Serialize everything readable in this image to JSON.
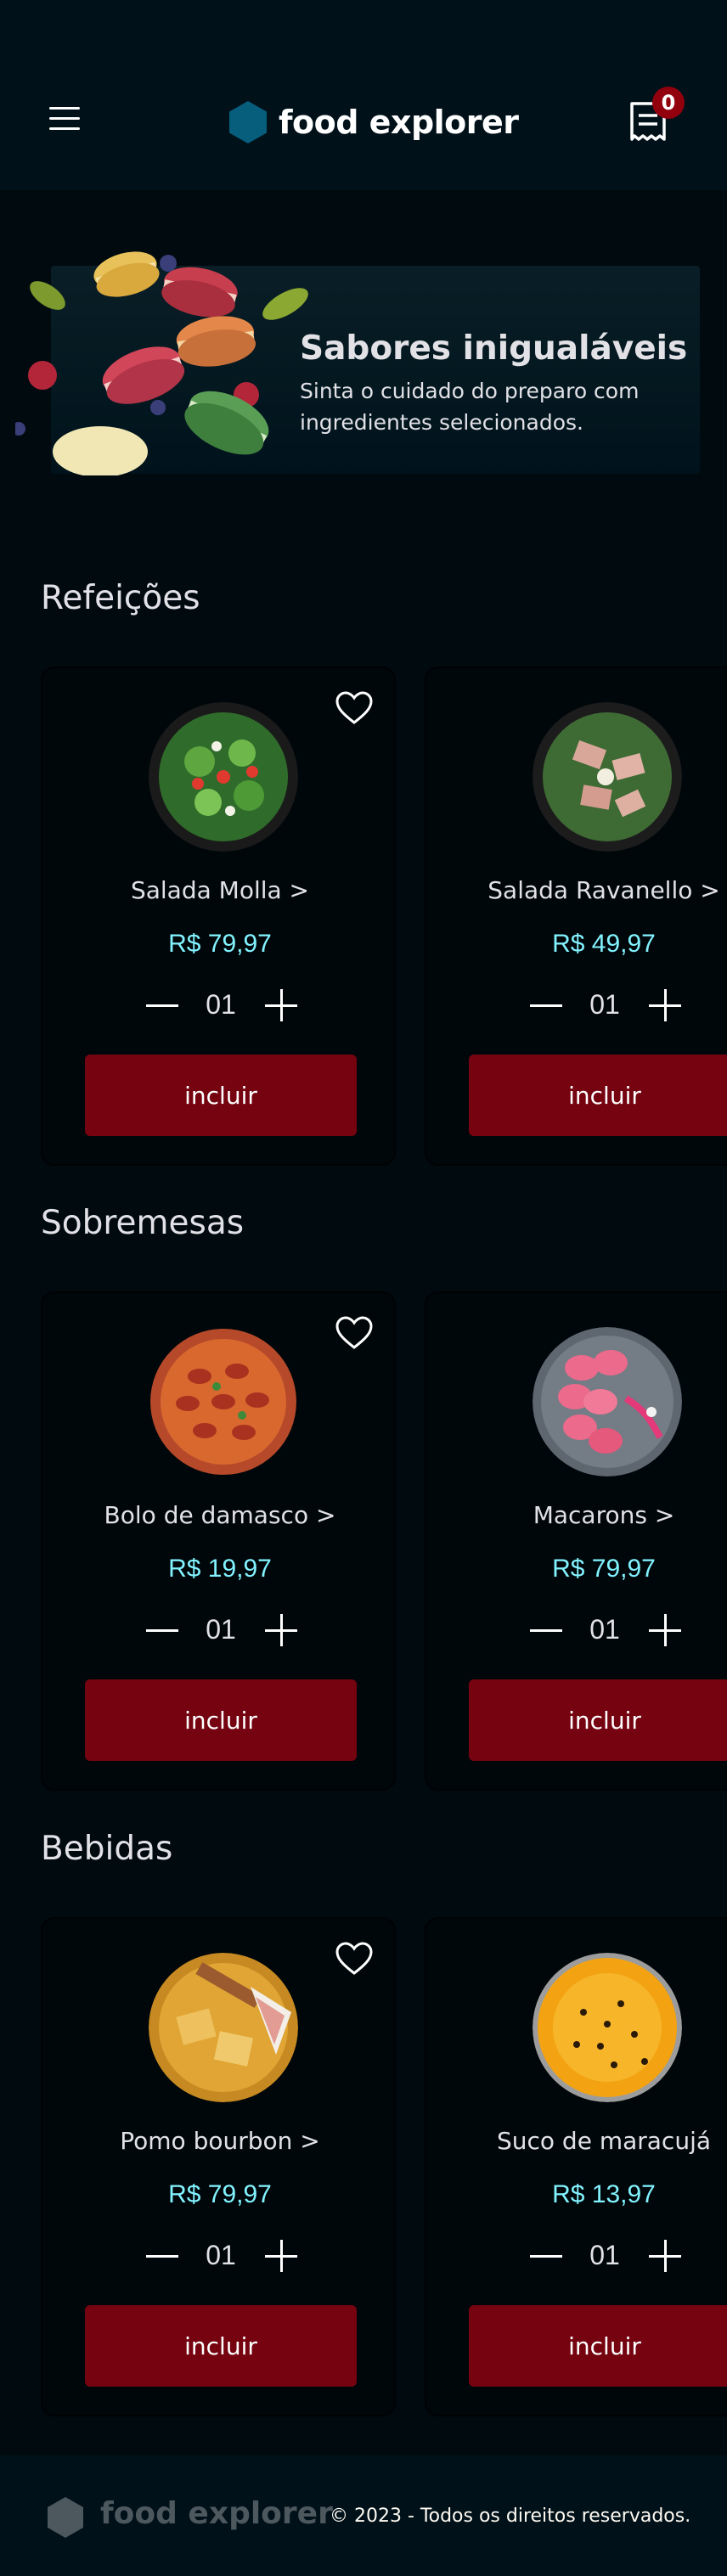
{
  "header": {
    "menu_icon": "hamburger-icon",
    "brand": "food explorer",
    "logo_icon": "hexagon-logo-icon",
    "cart_icon": "receipt-icon",
    "cart_count": "0"
  },
  "banner": {
    "title": "Sabores inigualáveis",
    "subtitle": "Sinta o cuidado do preparo com ingredientes selecionados."
  },
  "sections": [
    {
      "title": "Refeições",
      "items": [
        {
          "name": "Salada Molla >",
          "price": "R$ 79,97",
          "qty": "01",
          "button": "incluir"
        },
        {
          "name": "Salada Ravanello >",
          "price": "R$ 49,97",
          "qty": "01",
          "button": "incluir"
        }
      ]
    },
    {
      "title": "Sobremesas",
      "items": [
        {
          "name": "Bolo de damasco >",
          "price": "R$ 19,97",
          "qty": "01",
          "button": "incluir"
        },
        {
          "name": "Macarons >",
          "price": "R$ 79,97",
          "qty": "01",
          "button": "incluir"
        }
      ]
    },
    {
      "title": "Bebidas",
      "items": [
        {
          "name": "Pomo bourbon >",
          "price": "R$ 79,97",
          "qty": "01",
          "button": "incluir"
        },
        {
          "name": "Suco de maracujá",
          "price": "R$ 13,97",
          "qty": "01",
          "button": "incluir"
        }
      ]
    }
  ],
  "footer": {
    "brand": "food explorer",
    "copyright": "© 2023 - Todos os direitos reservados."
  },
  "colors": {
    "background": "#000A0F",
    "header": "#00111A",
    "price": "#82F3FF",
    "button": "#750310",
    "badge": "#92000E",
    "logo": "#065E7C"
  }
}
